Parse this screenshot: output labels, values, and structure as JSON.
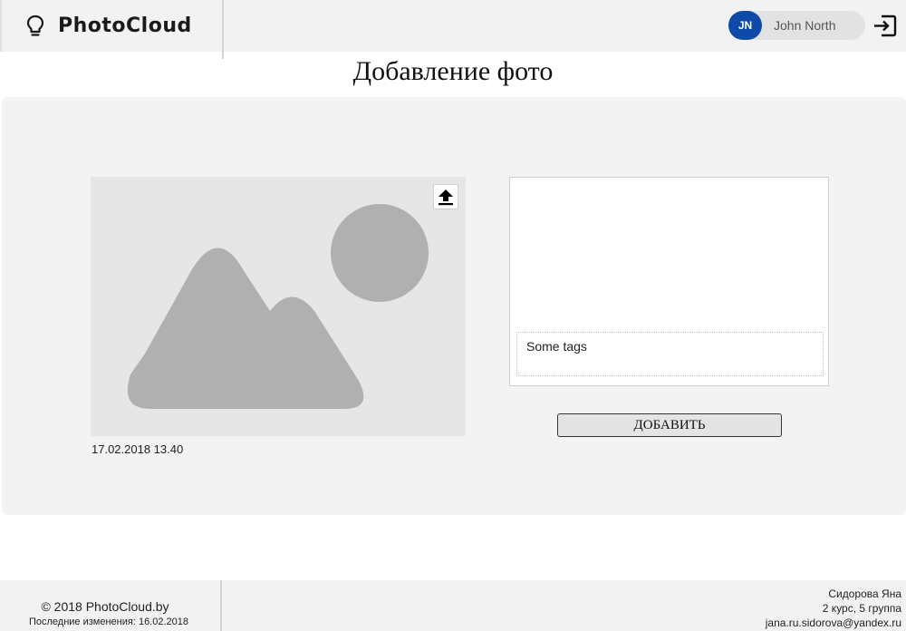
{
  "header": {
    "app_name": "PhotoCloud",
    "logo_icon": "lightbulb-icon",
    "user": {
      "initials": "JN",
      "name": "John North",
      "avatar_color": "#0e4aa8"
    },
    "logout_icon": "logout-icon"
  },
  "page": {
    "title": "Добавление фото"
  },
  "photo": {
    "placeholder_icon": "image-placeholder-icon",
    "upload_icon": "upload-icon",
    "date": "17.02.2018 13.40"
  },
  "form": {
    "tags_value": "Some tags",
    "add_button_label": "ДОБАВИТЬ"
  },
  "footer": {
    "copyright": "© 2018 PhotoCloud.by",
    "last_modified": "Последние изменения: 16.02.2018",
    "author_name": "Сидорова Яна",
    "author_course": "2 курс, 5 группа",
    "author_email": "jana.ru.sidorova@yandex.ru"
  },
  "colors": {
    "header_bg": "#f2f2f2",
    "panel_bg": "#f3f3f3",
    "avatar": "#0e4aa8",
    "placeholder_shape": "#b0b0b0"
  }
}
